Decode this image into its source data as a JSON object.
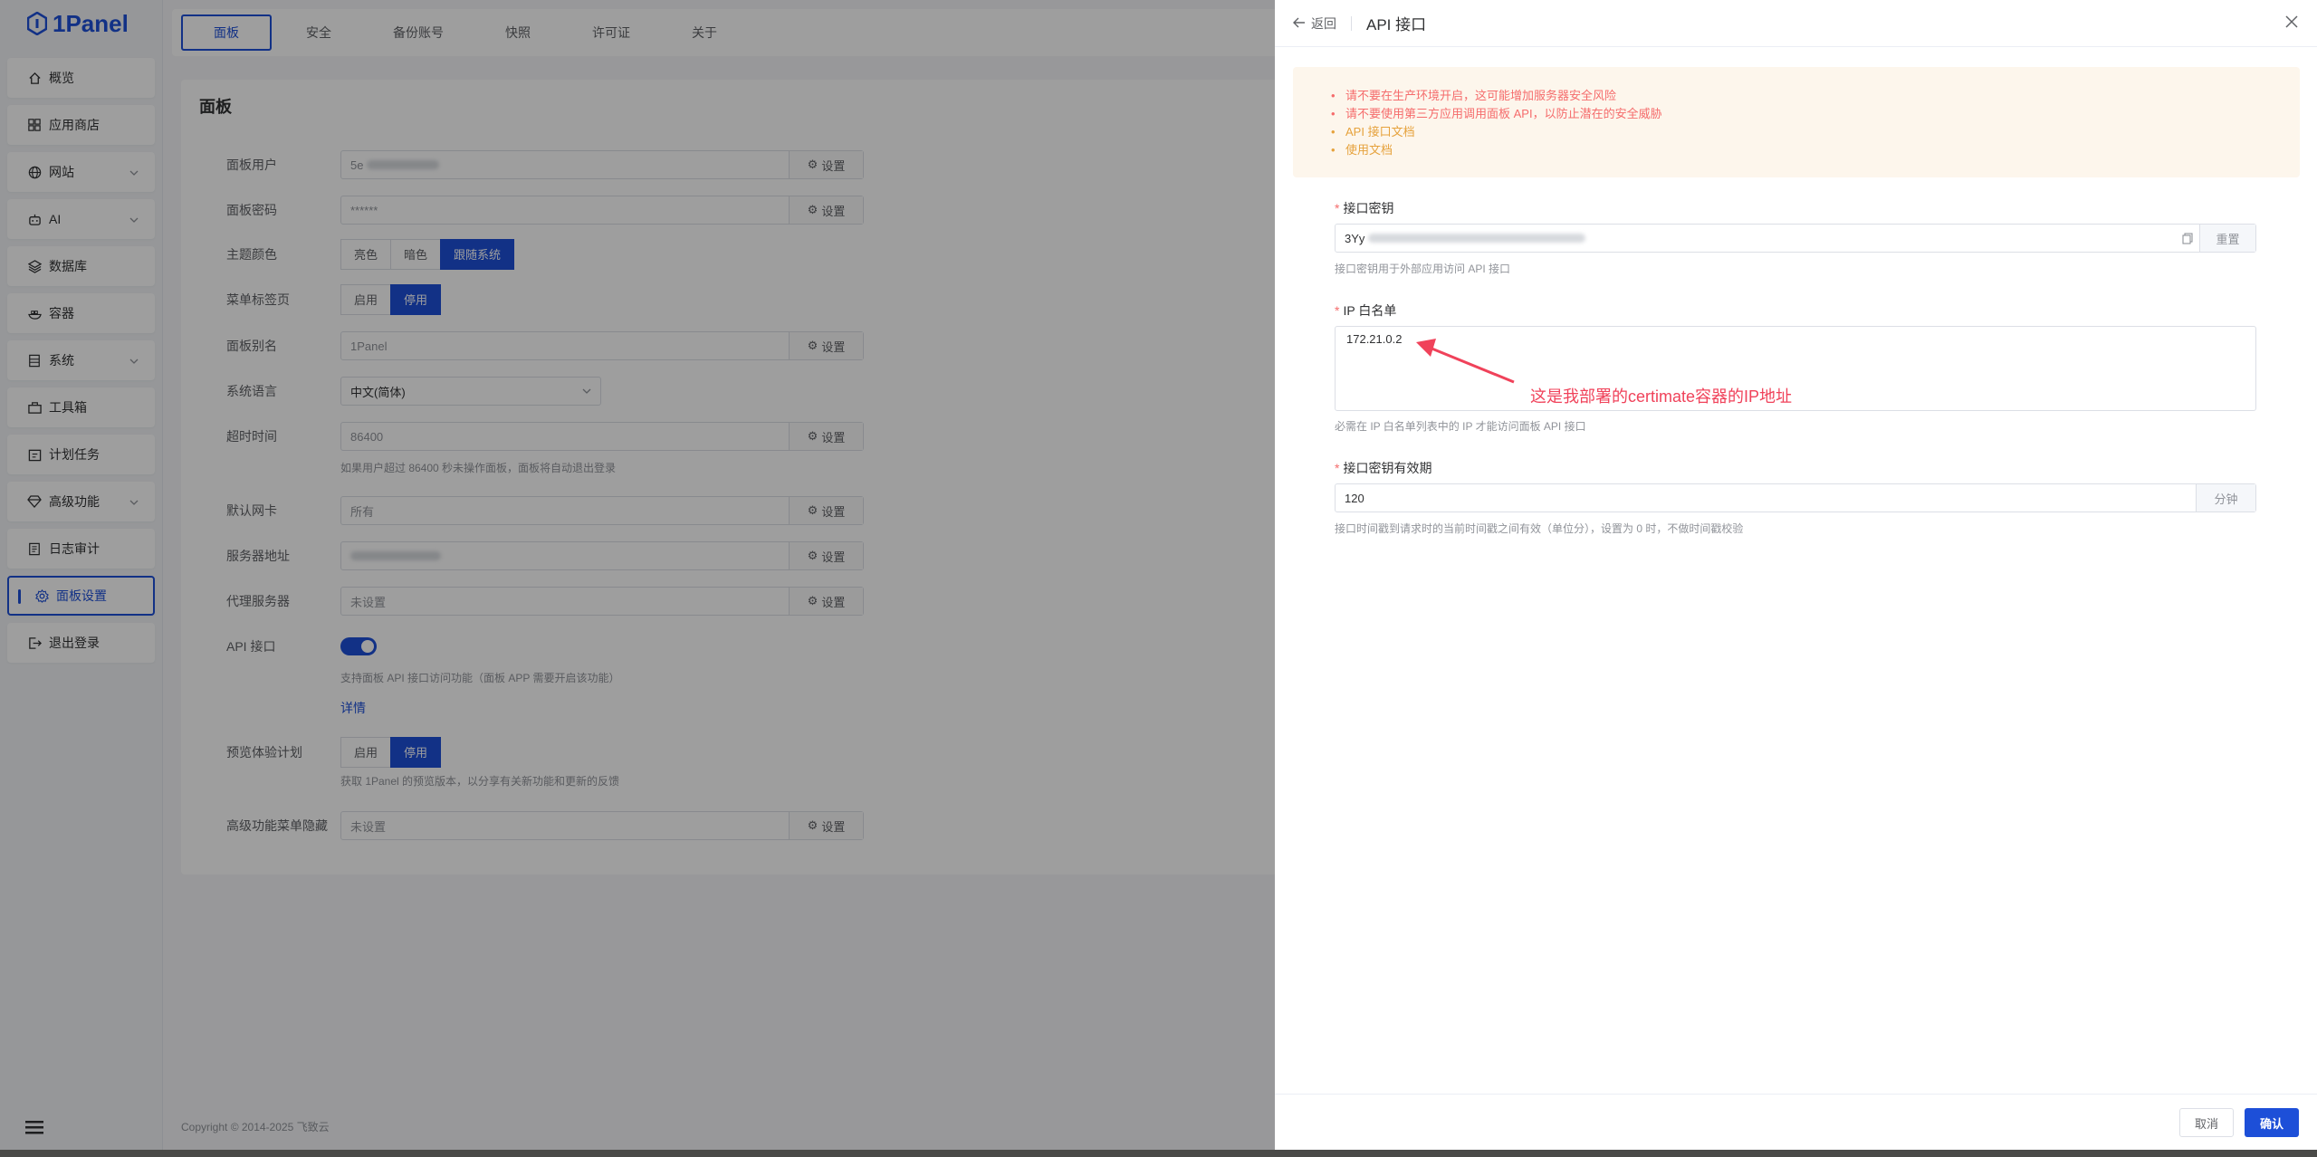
{
  "app": {
    "logo": "1Panel",
    "accent": "#1d4fd8"
  },
  "sidebar": {
    "items": [
      {
        "label": "概览",
        "icon": "home-icon"
      },
      {
        "label": "应用商店",
        "icon": "grid-icon"
      },
      {
        "label": "网站",
        "icon": "globe-icon"
      },
      {
        "label": "AI",
        "icon": "robot-icon"
      },
      {
        "label": "数据库",
        "icon": "database-icon"
      },
      {
        "label": "容器",
        "icon": "container-icon"
      },
      {
        "label": "系统",
        "icon": "system-icon"
      },
      {
        "label": "工具箱",
        "icon": "toolbox-icon"
      },
      {
        "label": "计划任务",
        "icon": "calendar-icon"
      },
      {
        "label": "高级功能",
        "icon": "diamond-icon"
      },
      {
        "label": "日志审计",
        "icon": "log-icon"
      },
      {
        "label": "面板设置",
        "icon": "gear-icon"
      },
      {
        "label": "退出登录",
        "icon": "logout-icon"
      }
    ],
    "active": "面板设置"
  },
  "tabs": [
    "面板",
    "安全",
    "备份账号",
    "快照",
    "许可证",
    "关于"
  ],
  "main": {
    "title": "面板",
    "set_label": "设置",
    "panel_user_label": "面板用户",
    "panel_user_value": "5e",
    "panel_password_label": "面板密码",
    "panel_password_value": "******",
    "theme_label": "主题颜色",
    "theme_options": [
      "亮色",
      "暗色",
      "跟随系统"
    ],
    "menu_tab_label": "菜单标签页",
    "enable": "启用",
    "disable": "停用",
    "alias_label": "面板别名",
    "alias_value": "1Panel",
    "language_label": "系统语言",
    "language_value": "中文(简体)",
    "timeout_label": "超时时间",
    "timeout_value": "86400",
    "timeout_hint": "如果用户超过 86400 秒未操作面板，面板将自动退出登录",
    "nic_label": "默认网卡",
    "nic_value": "所有",
    "server_addr_label": "服务器地址",
    "proxy_label": "代理服务器",
    "proxy_value": "未设置",
    "api_label": "API 接口",
    "api_hint": "支持面板 API 接口访问功能（面板 APP 需要开启该功能）",
    "details": "详情",
    "preview_label": "预览体验计划",
    "preview_hint": "获取 1Panel 的预览版本，以分享有关新功能和更新的反馈",
    "hide_menu_label": "高级功能菜单隐藏",
    "hide_menu_value": "未设置"
  },
  "footer": "Copyright © 2014-2025 飞致云",
  "drawer": {
    "back": "返回",
    "title": "API 接口",
    "alerts": [
      {
        "text": "请不要在生产环境开启，这可能增加服务器安全风险",
        "level": "error"
      },
      {
        "text": "请不要使用第三方应用调用面板 API，以防止潜在的安全威胁",
        "level": "error"
      },
      {
        "text": "API 接口文档",
        "level": "warning"
      },
      {
        "text": "使用文档",
        "level": "warning"
      }
    ],
    "key_label": "接口密钥",
    "key_value": "3Yy",
    "key_reset": "重置",
    "key_hint": "接口密钥用于外部应用访问 API 接口",
    "whitelist_label": "IP 白名单",
    "whitelist_value": "172.21.0.2",
    "whitelist_hint": "必需在 IP 白名单列表中的 IP 才能访问面板 API 接口",
    "validity_label": "接口密钥有效期",
    "validity_value": "120",
    "validity_unit": "分钟",
    "validity_hint": "接口时间戳到请求时的当前时间戳之间有效（单位分），设置为 0 时，不做时间戳校验",
    "annotation": "这是我部署的certimate容器的IP地址",
    "cancel": "取消",
    "confirm": "确认"
  }
}
